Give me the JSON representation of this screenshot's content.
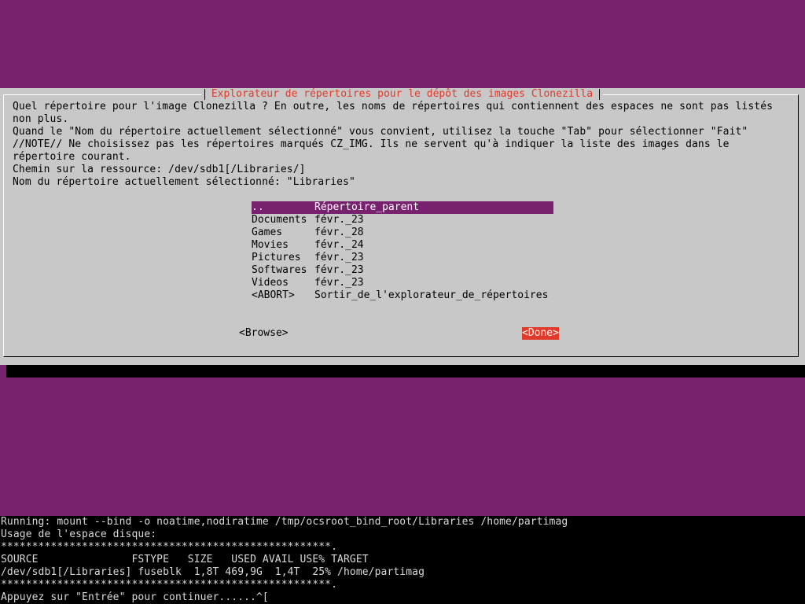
{
  "dialog": {
    "title": "Explorateur de répertoires pour le dépôt des images Clonezilla",
    "lines": [
      "Quel répertoire pour l'image Clonezilla ? En outre, les noms de répertoires qui contiennent des espaces ne sont pas listés",
      "non plus.",
      "Quand le \"Nom du répertoire actuellement sélectionné\" vous convient, utilisez la touche \"Tab\" pour sélectionner \"Fait\"",
      "//NOTE// Ne choisissez pas les répertoires marqués CZ_IMG. Ils ne servent qu'à indiquer la liste des images dans le",
      "répertoire courant.",
      "Chemin sur la ressource: /dev/sdb1[/Libraries/]",
      "Nom du répertoire actuellement sélectionné: \"Libraries\""
    ],
    "items": [
      {
        "name": "..",
        "value": "Répertoire_parent"
      },
      {
        "name": "Documents",
        "value": "févr._23"
      },
      {
        "name": "Games",
        "value": "févr._28"
      },
      {
        "name": "Movies",
        "value": "févr._24"
      },
      {
        "name": "Pictures",
        "value": "févr._23"
      },
      {
        "name": "Softwares",
        "value": "févr._23"
      },
      {
        "name": "Videos",
        "value": "févr._23"
      },
      {
        "name": "<ABORT>",
        "value": "Sortir_de_l'explorateur_de_répertoires"
      }
    ],
    "browse_label": "<Browse>",
    "done_label": "<Done>"
  },
  "terminal": {
    "lines": [
      "Running: mount --bind -o noatime,nodiratime /tmp/ocsroot_bind_root/Libraries /home/partimag",
      "Usage de l'espace disque:",
      "*****************************************************.",
      "SOURCE               FSTYPE   SIZE   USED AVAIL USE% TARGET",
      "/dev/sdb1[/Libraries] fuseblk  1,8T 469,9G  1,4T  25% /home/partimag",
      "*****************************************************.",
      "Appuyez sur \"Entrée\" pour continuer......^["
    ]
  },
  "colors": {
    "background": "#77216f",
    "dialog": "#c8c8c8",
    "title": "#e03a2a",
    "selected": "#77216f",
    "active_button": "#e03a2a"
  }
}
